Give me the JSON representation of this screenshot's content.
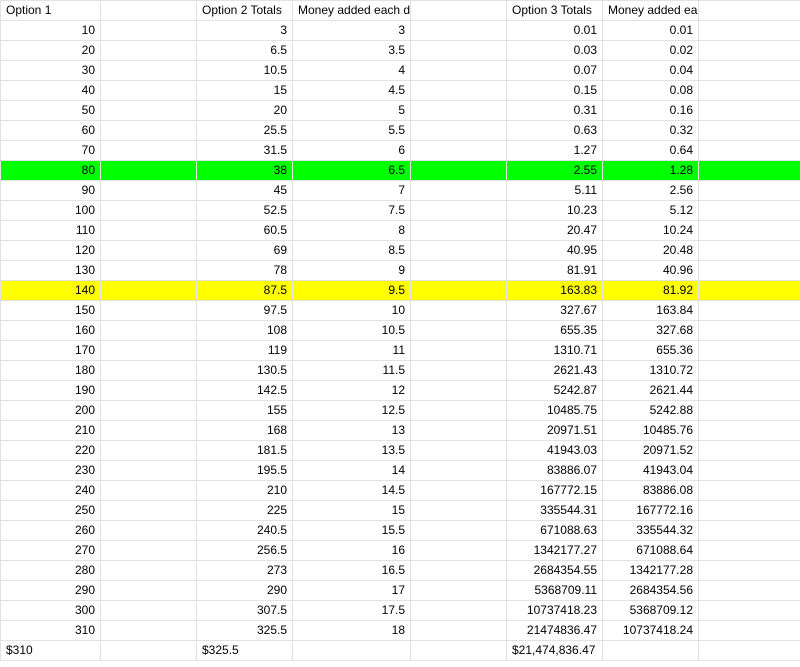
{
  "headers": [
    "Option 1",
    "",
    "Option 2 Totals",
    "Money added each day",
    "",
    "Option 3 Totals",
    "Money added each day",
    ""
  ],
  "rows": [
    {
      "cells": [
        "10",
        "",
        "3",
        "3",
        "",
        "0.01",
        "0.01",
        ""
      ]
    },
    {
      "cells": [
        "20",
        "",
        "6.5",
        "3.5",
        "",
        "0.03",
        "0.02",
        ""
      ]
    },
    {
      "cells": [
        "30",
        "",
        "10.5",
        "4",
        "",
        "0.07",
        "0.04",
        ""
      ]
    },
    {
      "cells": [
        "40",
        "",
        "15",
        "4.5",
        "",
        "0.15",
        "0.08",
        ""
      ]
    },
    {
      "cells": [
        "50",
        "",
        "20",
        "5",
        "",
        "0.31",
        "0.16",
        ""
      ]
    },
    {
      "cells": [
        "60",
        "",
        "25.5",
        "5.5",
        "",
        "0.63",
        "0.32",
        ""
      ]
    },
    {
      "cells": [
        "70",
        "",
        "31.5",
        "6",
        "",
        "1.27",
        "0.64",
        ""
      ]
    },
    {
      "cells": [
        "80",
        "",
        "38",
        "6.5",
        "",
        "2.55",
        "1.28",
        ""
      ],
      "highlight": "#00ff00"
    },
    {
      "cells": [
        "90",
        "",
        "45",
        "7",
        "",
        "5.11",
        "2.56",
        ""
      ]
    },
    {
      "cells": [
        "100",
        "",
        "52.5",
        "7.5",
        "",
        "10.23",
        "5.12",
        ""
      ]
    },
    {
      "cells": [
        "110",
        "",
        "60.5",
        "8",
        "",
        "20.47",
        "10.24",
        ""
      ]
    },
    {
      "cells": [
        "120",
        "",
        "69",
        "8.5",
        "",
        "40.95",
        "20.48",
        ""
      ]
    },
    {
      "cells": [
        "130",
        "",
        "78",
        "9",
        "",
        "81.91",
        "40.96",
        ""
      ]
    },
    {
      "cells": [
        "140",
        "",
        "87.5",
        "9.5",
        "",
        "163.83",
        "81.92",
        ""
      ],
      "highlight": "#ffff00"
    },
    {
      "cells": [
        "150",
        "",
        "97.5",
        "10",
        "",
        "327.67",
        "163.84",
        ""
      ]
    },
    {
      "cells": [
        "160",
        "",
        "108",
        "10.5",
        "",
        "655.35",
        "327.68",
        ""
      ]
    },
    {
      "cells": [
        "170",
        "",
        "119",
        "11",
        "",
        "1310.71",
        "655.36",
        ""
      ]
    },
    {
      "cells": [
        "180",
        "",
        "130.5",
        "11.5",
        "",
        "2621.43",
        "1310.72",
        ""
      ]
    },
    {
      "cells": [
        "190",
        "",
        "142.5",
        "12",
        "",
        "5242.87",
        "2621.44",
        ""
      ]
    },
    {
      "cells": [
        "200",
        "",
        "155",
        "12.5",
        "",
        "10485.75",
        "5242.88",
        ""
      ]
    },
    {
      "cells": [
        "210",
        "",
        "168",
        "13",
        "",
        "20971.51",
        "10485.76",
        ""
      ]
    },
    {
      "cells": [
        "220",
        "",
        "181.5",
        "13.5",
        "",
        "41943.03",
        "20971.52",
        ""
      ]
    },
    {
      "cells": [
        "230",
        "",
        "195.5",
        "14",
        "",
        "83886.07",
        "41943.04",
        ""
      ]
    },
    {
      "cells": [
        "240",
        "",
        "210",
        "14.5",
        "",
        "167772.15",
        "83886.08",
        ""
      ]
    },
    {
      "cells": [
        "250",
        "",
        "225",
        "15",
        "",
        "335544.31",
        "167772.16",
        ""
      ]
    },
    {
      "cells": [
        "260",
        "",
        "240.5",
        "15.5",
        "",
        "671088.63",
        "335544.32",
        ""
      ]
    },
    {
      "cells": [
        "270",
        "",
        "256.5",
        "16",
        "",
        "1342177.27",
        "671088.64",
        ""
      ]
    },
    {
      "cells": [
        "280",
        "",
        "273",
        "16.5",
        "",
        "2684354.55",
        "1342177.28",
        ""
      ]
    },
    {
      "cells": [
        "290",
        "",
        "290",
        "17",
        "",
        "5368709.11",
        "2684354.56",
        ""
      ]
    },
    {
      "cells": [
        "300",
        "",
        "307.5",
        "17.5",
        "",
        "10737418.23",
        "5368709.12",
        ""
      ]
    },
    {
      "cells": [
        "310",
        "",
        "325.5",
        "18",
        "",
        "21474836.47",
        "10737418.24",
        ""
      ]
    }
  ],
  "totals": [
    "$310",
    "",
    "$325.5",
    "",
    "",
    "$21,474,836.47",
    "",
    ""
  ]
}
